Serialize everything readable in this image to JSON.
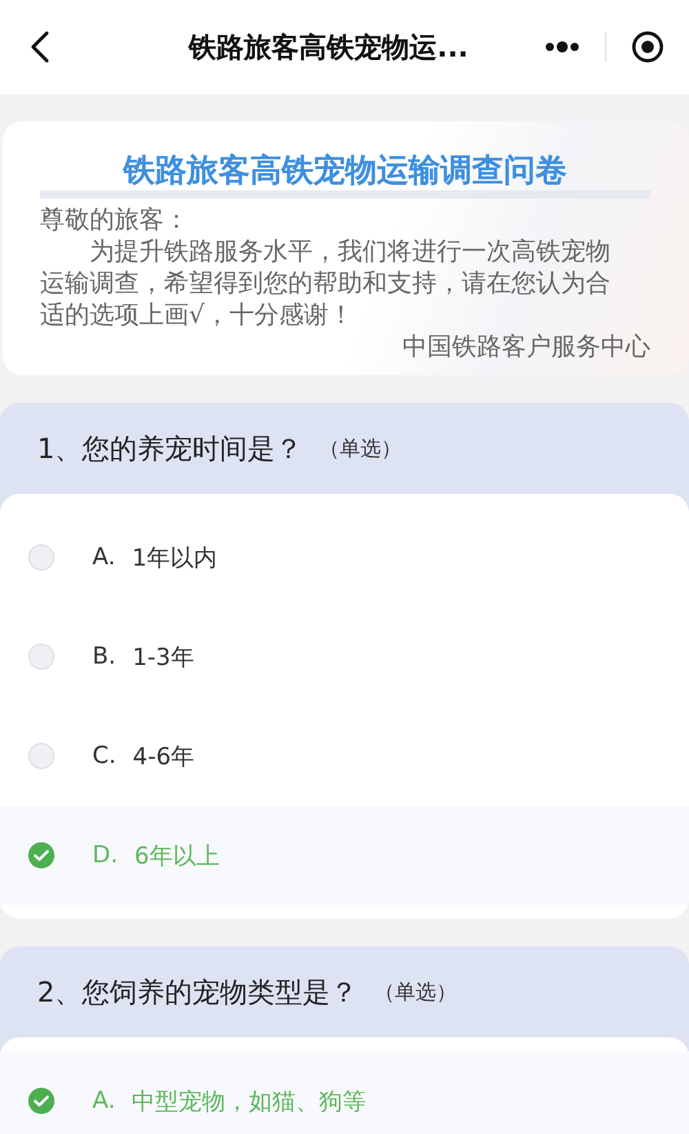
{
  "nav_bar": {
    "title": "铁路旅客高铁宠物运..."
  },
  "intro": {
    "title": "铁路旅客高铁宠物运输调查问卷",
    "greeting": "尊敬的旅客：",
    "body": "为提升铁路服务水平，我们将进行一次高铁宠物运输调查，希望得到您的帮助和支持，请在您认为合适的选项上画√，十分感谢！",
    "signature": "中国铁路客户服务中心"
  },
  "questions": [
    {
      "title": "1、您的养宠时间是？",
      "type_label": "（单选）",
      "options": [
        {
          "letter": "A.",
          "text": "1年以内",
          "selected": false
        },
        {
          "letter": "B.",
          "text": "1-3年",
          "selected": false
        },
        {
          "letter": "C.",
          "text": "4-6年",
          "selected": false
        },
        {
          "letter": "D.",
          "text": "6年以上",
          "selected": true
        }
      ]
    },
    {
      "title": "2、您饲养的宠物类型是？",
      "type_label": "（单选）",
      "options": [
        {
          "letter": "A.",
          "text": "中型宠物，如猫、狗等",
          "selected": true
        }
      ]
    }
  ]
}
